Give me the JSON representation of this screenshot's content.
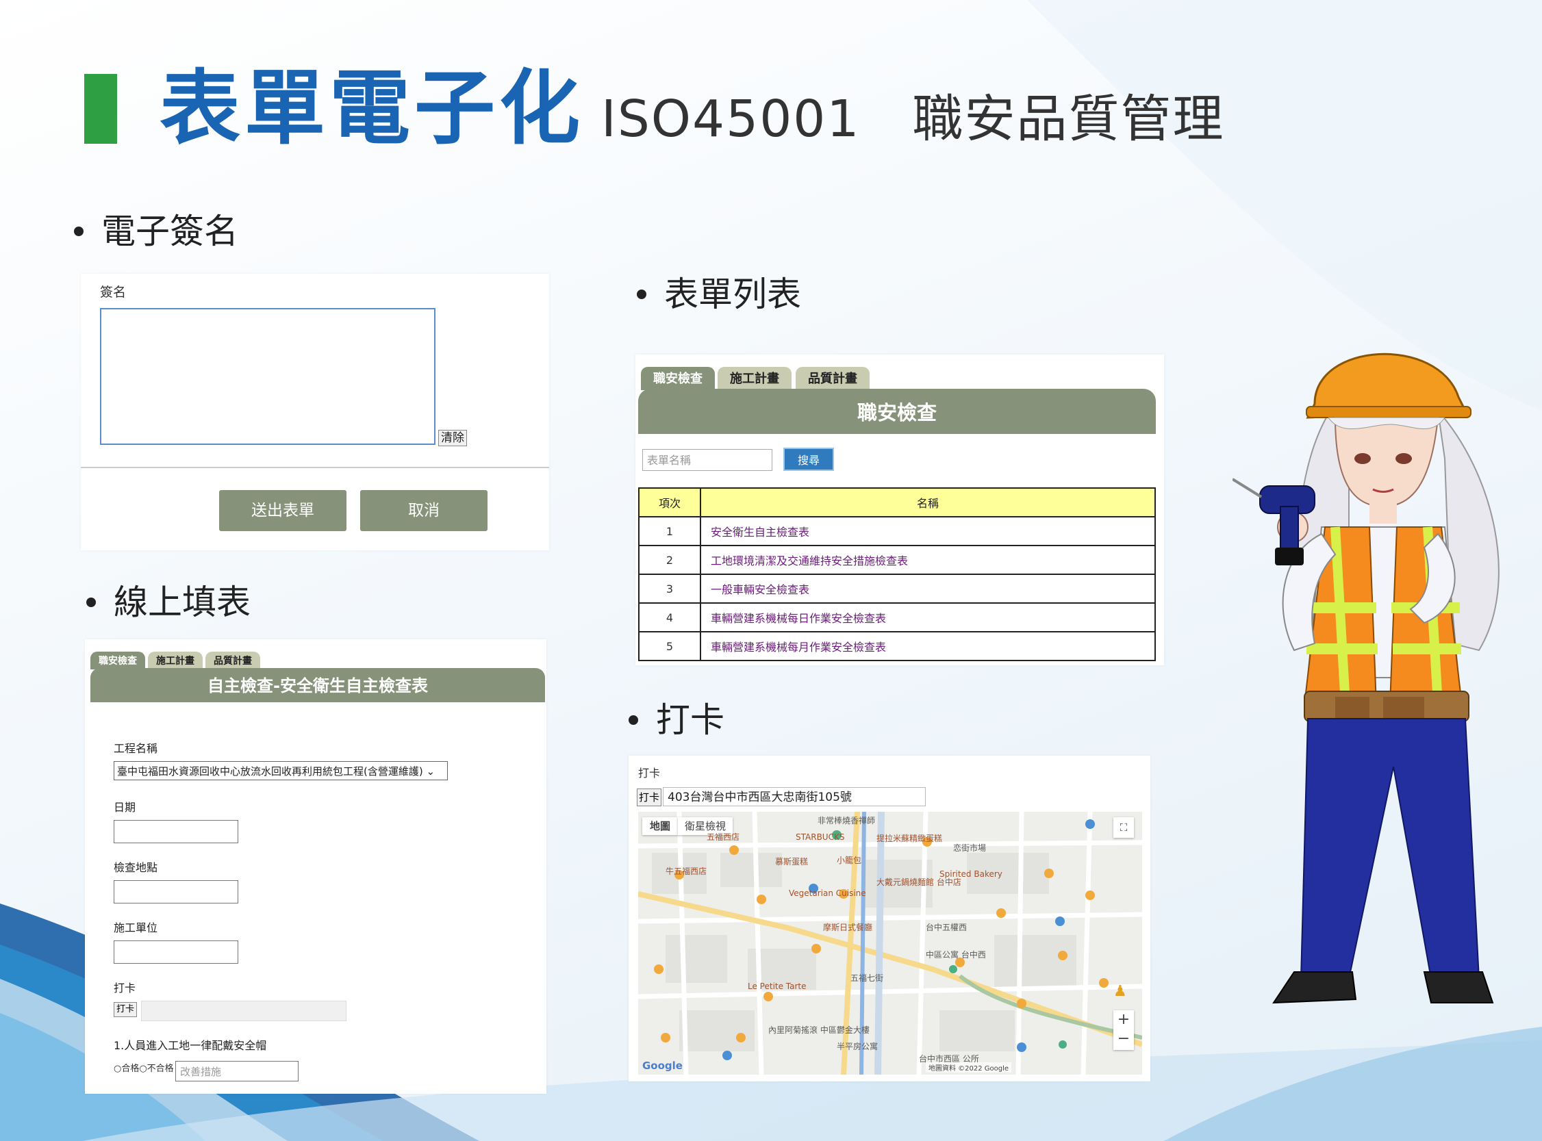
{
  "header": {
    "title": "表單電子化",
    "subtitle": "ISO45001　職安品質管理"
  },
  "sections": {
    "signature": "電子簽名",
    "form_list": "表單列表",
    "online_form": "線上填表",
    "punch": "打卡"
  },
  "signature_panel": {
    "label": "簽名",
    "clear_button": "清除",
    "submit_button": "送出表單",
    "cancel_button": "取消"
  },
  "form_list_panel": {
    "tabs": [
      "職安檢查",
      "施工計畫",
      "品質計畫"
    ],
    "active_tab": "職安檢查",
    "header": "職安檢查",
    "search_placeholder": "表單名稱",
    "search_button": "搜尋",
    "columns": [
      "項次",
      "名稱"
    ],
    "rows": [
      {
        "no": "1",
        "name": "安全衛生自主檢查表"
      },
      {
        "no": "2",
        "name": "工地環境清潔及交通維持安全措施檢查表"
      },
      {
        "no": "3",
        "name": "一般車輛安全檢查表"
      },
      {
        "no": "4",
        "name": "車輛營建系機械每日作業安全檢查表"
      },
      {
        "no": "5",
        "name": "車輛營建系機械每月作業安全檢查表"
      }
    ]
  },
  "online_form_panel": {
    "tabs": [
      "職安檢查",
      "施工計畫",
      "品質計畫"
    ],
    "header": "自主檢查-安全衛生自主檢查表",
    "fields": {
      "project_label": "工程名稱",
      "project_value": "臺中屯福田水資源回收中心放流水回收再利用統包工程(含營運維護)",
      "date_label": "日期",
      "location_label": "檢查地點",
      "unit_label": "施工單位",
      "punch_label": "打卡",
      "punch_button": "打卡"
    },
    "item1": "1.人員進入工地一律配戴安全帽",
    "item1_options": "○合格○不合格",
    "item1_placeholder": "改善措施"
  },
  "punch_panel": {
    "label": "打卡",
    "button": "打卡",
    "address": "403台灣台中市西區大忠南街105號",
    "map_types": [
      "地圖",
      "衛星檢視"
    ],
    "pois": [
      "非常棒燒香禪師",
      "五福西店",
      "牛五福西店",
      "STARBUCKS",
      "小籠包",
      "慕斯蛋糕",
      "Vegetarian Cuisine",
      "摩斯日式餐廳",
      "提拉米蘇精緻蛋糕",
      "恋街市場",
      "Spirited Bakery",
      "大戴元鍋燒麵館 台中店",
      "台中五權西",
      "Le Petite Tarte",
      "中區公寓 台中西",
      "五福七街",
      "半平房公寓",
      "台中市西區 公所",
      "內里阿菊搖滾 中區鬱金大樓"
    ],
    "attribution": "地圖資料 ©2022 Google",
    "google": "Google"
  }
}
